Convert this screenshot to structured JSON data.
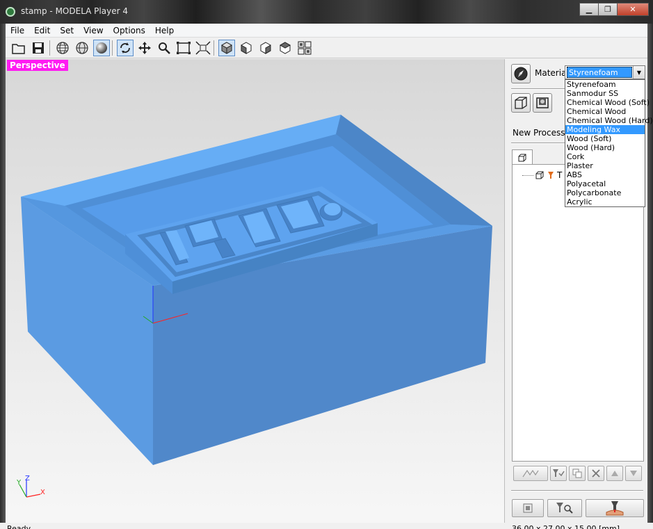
{
  "window": {
    "title": "stamp - MODELA Player 4"
  },
  "menu": [
    "File",
    "Edit",
    "Set",
    "View",
    "Options",
    "Help"
  ],
  "viewport": {
    "view_label": "Perspective",
    "axis": {
      "y": "Y",
      "z": "Z",
      "x": "X"
    }
  },
  "panel": {
    "material_label": "Material",
    "material_selected": "Styrenefoam",
    "material_options": [
      "Styrenefoam",
      "Sanmodur SS",
      "Chemical Wood (Soft)",
      "Chemical Wood",
      "Chemical Wood (Hard)",
      "Modeling Wax",
      "Wood (Soft)",
      "Wood (Hard)",
      "Cork",
      "Plaster",
      "ABS",
      "Polyacetal",
      "Polycarbonate",
      "Acrylic"
    ],
    "highlighted_option": "Modeling Wax",
    "new_process_label": "New Process",
    "tree_item_label": "T"
  },
  "status": {
    "left": "Ready",
    "right": "36.00 x 27.00 x 15.00 [mm]"
  },
  "colors": {
    "model_top": "#5aa2ef",
    "model_side": "#4f88cc",
    "highlight": "#3399ff",
    "view_label_bg": "#ff1cf2"
  }
}
